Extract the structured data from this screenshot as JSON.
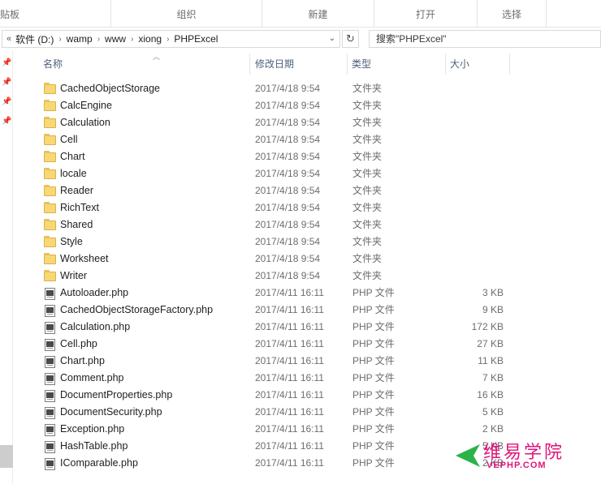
{
  "ribbon": {
    "groups": [
      "贴板",
      "组织",
      "新建",
      "打开",
      "选择"
    ]
  },
  "address": {
    "back_glyph": "«",
    "crumbs": [
      "软件 (D:)",
      "wamp",
      "www",
      "xiong",
      "PHPExcel"
    ],
    "crumb_separator": "›",
    "dropdown_glyph": "⌄",
    "refresh_glyph": "↻"
  },
  "search": {
    "placeholder": "搜索\"PHPExcel\""
  },
  "columns": {
    "name": "名称",
    "modified": "修改日期",
    "type": "类型",
    "size": "大小"
  },
  "files": [
    {
      "icon": "folder-icon",
      "name": "CachedObjectStorage",
      "modified": "2017/4/18 9:54",
      "type": "文件夹",
      "size": ""
    },
    {
      "icon": "folder-icon",
      "name": "CalcEngine",
      "modified": "2017/4/18 9:54",
      "type": "文件夹",
      "size": ""
    },
    {
      "icon": "folder-icon",
      "name": "Calculation",
      "modified": "2017/4/18 9:54",
      "type": "文件夹",
      "size": ""
    },
    {
      "icon": "folder-icon",
      "name": "Cell",
      "modified": "2017/4/18 9:54",
      "type": "文件夹",
      "size": ""
    },
    {
      "icon": "folder-icon",
      "name": "Chart",
      "modified": "2017/4/18 9:54",
      "type": "文件夹",
      "size": ""
    },
    {
      "icon": "folder-icon",
      "name": "locale",
      "modified": "2017/4/18 9:54",
      "type": "文件夹",
      "size": ""
    },
    {
      "icon": "folder-icon",
      "name": "Reader",
      "modified": "2017/4/18 9:54",
      "type": "文件夹",
      "size": ""
    },
    {
      "icon": "folder-icon",
      "name": "RichText",
      "modified": "2017/4/18 9:54",
      "type": "文件夹",
      "size": ""
    },
    {
      "icon": "folder-icon",
      "name": "Shared",
      "modified": "2017/4/18 9:54",
      "type": "文件夹",
      "size": ""
    },
    {
      "icon": "folder-icon",
      "name": "Style",
      "modified": "2017/4/18 9:54",
      "type": "文件夹",
      "size": ""
    },
    {
      "icon": "folder-icon",
      "name": "Worksheet",
      "modified": "2017/4/18 9:54",
      "type": "文件夹",
      "size": ""
    },
    {
      "icon": "folder-icon",
      "name": "Writer",
      "modified": "2017/4/18 9:54",
      "type": "文件夹",
      "size": ""
    },
    {
      "icon": "php-file-icon",
      "name": "Autoloader.php",
      "modified": "2017/4/11 16:11",
      "type": "PHP 文件",
      "size": "3 KB"
    },
    {
      "icon": "php-file-icon",
      "name": "CachedObjectStorageFactory.php",
      "modified": "2017/4/11 16:11",
      "type": "PHP 文件",
      "size": "9 KB"
    },
    {
      "icon": "php-file-icon",
      "name": "Calculation.php",
      "modified": "2017/4/11 16:11",
      "type": "PHP 文件",
      "size": "172 KB"
    },
    {
      "icon": "php-file-icon",
      "name": "Cell.php",
      "modified": "2017/4/11 16:11",
      "type": "PHP 文件",
      "size": "27 KB"
    },
    {
      "icon": "php-file-icon",
      "name": "Chart.php",
      "modified": "2017/4/11 16:11",
      "type": "PHP 文件",
      "size": "11 KB"
    },
    {
      "icon": "php-file-icon",
      "name": "Comment.php",
      "modified": "2017/4/11 16:11",
      "type": "PHP 文件",
      "size": "7 KB"
    },
    {
      "icon": "php-file-icon",
      "name": "DocumentProperties.php",
      "modified": "2017/4/11 16:11",
      "type": "PHP 文件",
      "size": "16 KB"
    },
    {
      "icon": "php-file-icon",
      "name": "DocumentSecurity.php",
      "modified": "2017/4/11 16:11",
      "type": "PHP 文件",
      "size": "5 KB"
    },
    {
      "icon": "php-file-icon",
      "name": "Exception.php",
      "modified": "2017/4/11 16:11",
      "type": "PHP 文件",
      "size": "2 KB"
    },
    {
      "icon": "php-file-icon",
      "name": "HashTable.php",
      "modified": "2017/4/11 16:11",
      "type": "PHP 文件",
      "size": "5 KB"
    },
    {
      "icon": "php-file-icon",
      "name": "IComparable.php",
      "modified": "2017/4/11 16:11",
      "type": "PHP 文件",
      "size": "2 KB"
    }
  ],
  "watermark": {
    "cn": "维易学院",
    "en": "VEPHP.COM",
    "color": "#e0147a",
    "arrow_color": "#2bb34a"
  },
  "colors": {
    "header_text": "#4c607a",
    "folder": "#f8d775",
    "secondary_text": "#6d6d6d"
  }
}
